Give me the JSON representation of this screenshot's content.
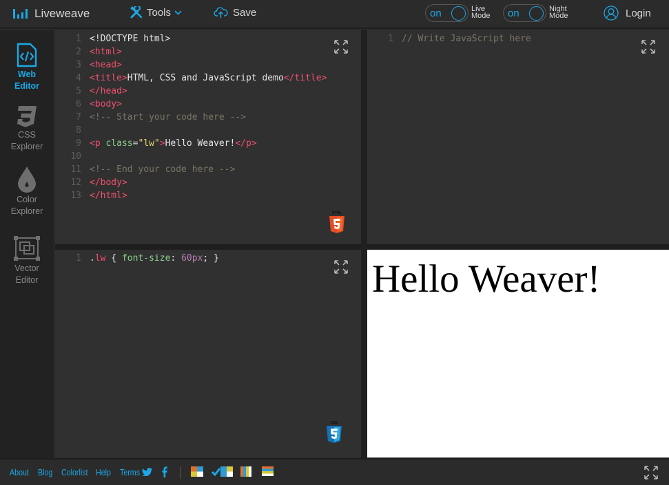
{
  "app": {
    "title": "Liveweave"
  },
  "header": {
    "logo_text": "Liveweave",
    "tools_label": "Tools",
    "save_label": "Save",
    "live_mode": {
      "state": "on",
      "label_line1": "Live",
      "label_line2": "Mode"
    },
    "night_mode": {
      "state": "on",
      "label_line1": "Night",
      "label_line2": "Mode"
    },
    "login_label": "Login",
    "accent_color": "#1ba8e6"
  },
  "sidebar": {
    "items": [
      {
        "line1": "Web",
        "line2": "Editor",
        "icon": "code-file-icon",
        "active": true
      },
      {
        "line1": "CSS",
        "line2": "Explorer",
        "icon": "css3-icon",
        "active": false
      },
      {
        "line1": "Color",
        "line2": "Explorer",
        "icon": "drop-icon",
        "active": false
      },
      {
        "line1": "Vector",
        "line2": "Editor",
        "icon": "vector-icon",
        "active": false
      }
    ]
  },
  "html_editor": {
    "lines": [
      {
        "n": "1",
        "tokens": [
          [
            "txt",
            "<!DOCTYPE html>"
          ]
        ]
      },
      {
        "n": "2",
        "tokens": [
          [
            "tag",
            "<html>"
          ]
        ]
      },
      {
        "n": "3",
        "tokens": [
          [
            "tag",
            "<head>"
          ]
        ]
      },
      {
        "n": "4",
        "tokens": [
          [
            "tag",
            "<title>"
          ],
          [
            "txt",
            "HTML, CSS and JavaScript demo"
          ],
          [
            "tag",
            "</title>"
          ]
        ]
      },
      {
        "n": "5",
        "tokens": [
          [
            "tag",
            "</head>"
          ]
        ]
      },
      {
        "n": "6",
        "tokens": [
          [
            "tag",
            "<body>"
          ]
        ]
      },
      {
        "n": "7",
        "tokens": [
          [
            "comment",
            "<!-- Start your code here -->"
          ]
        ]
      },
      {
        "n": "8",
        "tokens": []
      },
      {
        "n": "9",
        "tokens": [
          [
            "tag",
            "<p "
          ],
          [
            "attr",
            "class"
          ],
          [
            "txt",
            "="
          ],
          [
            "str",
            "\"lw\""
          ],
          [
            "tag",
            ">"
          ],
          [
            "txt",
            "Hello Weaver!"
          ],
          [
            "tag",
            "</p>"
          ]
        ]
      },
      {
        "n": "10",
        "tokens": []
      },
      {
        "n": "11",
        "tokens": [
          [
            "comment",
            "<!-- End your code here -->"
          ]
        ]
      },
      {
        "n": "12",
        "tokens": [
          [
            "tag",
            "</body>"
          ]
        ]
      },
      {
        "n": "13",
        "tokens": [
          [
            "tag",
            "</html>"
          ]
        ]
      }
    ],
    "badge": "HTML5"
  },
  "js_editor": {
    "lines": [
      {
        "n": "1",
        "tokens": [
          [
            "comment",
            "// Write JavaScript here"
          ]
        ]
      }
    ]
  },
  "css_editor": {
    "lines": [
      {
        "n": "1",
        "tokens": [
          [
            "plain",
            "."
          ],
          [
            "sel",
            "lw"
          ],
          [
            "plain",
            " { "
          ],
          [
            "prop",
            "font-size"
          ],
          [
            "plain",
            ": "
          ],
          [
            "num",
            "60px"
          ],
          [
            "plain",
            "; }"
          ]
        ]
      }
    ],
    "badge": "CSS3"
  },
  "output": {
    "text": "Hello Weaver!"
  },
  "footer": {
    "links": [
      "About",
      "Blog",
      "Colorlist",
      "Help",
      "Terms"
    ],
    "social": [
      "twitter-icon",
      "facebook-icon"
    ],
    "layout_icons": [
      "layout-grid-icon",
      "layout-grid-selected-icon",
      "layout-columns-icon",
      "layout-rows-icon"
    ]
  }
}
